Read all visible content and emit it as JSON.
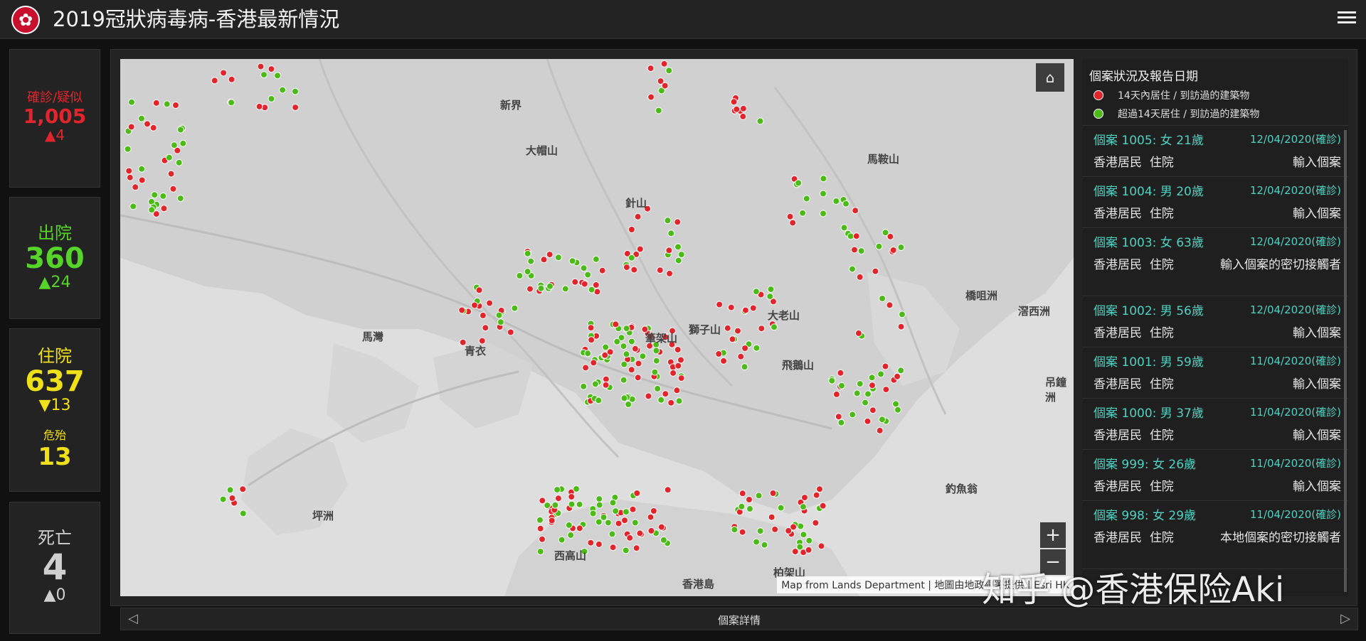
{
  "header": {
    "title": "2019冠狀病毒病-香港最新情況"
  },
  "stats": {
    "confirmed": {
      "label": "確診/疑似",
      "value": "1,005",
      "delta": "▲4",
      "color": "#e0262c"
    },
    "discharged": {
      "label": "出院",
      "value": "360",
      "delta": "▲24",
      "color": "#56d42a"
    },
    "hospitalised": {
      "label": "住院",
      "value": "637",
      "delta": "▼13",
      "critical_label": "危殆",
      "critical_value": "13",
      "color": "#f0e01a"
    },
    "deaths": {
      "label": "死亡",
      "value": "4",
      "delta": "▲0",
      "color": "#cfcfcf"
    }
  },
  "map": {
    "places": [
      "新界",
      "大帽山",
      "針山",
      "馬鞍山",
      "青衣",
      "馬灣",
      "筆架山",
      "獅子山",
      "大老山",
      "飛鵝山",
      "橋咀洲",
      "滘西洲",
      "吊鐘洲",
      "釣魚翁",
      "西高山",
      "香港島",
      "柏架山",
      "坪洲"
    ],
    "attribution": "Map from Lands Department | 地圖由地政總署提供 | Esri HK",
    "zoom_in": "+",
    "zoom_out": "−"
  },
  "legend": {
    "title": "個案狀況及報告日期",
    "items": [
      {
        "label": "14天內居住 / 到訪過的建築物",
        "color": "#e0262c"
      },
      {
        "label": "超過14天居住 / 到訪過的建築物",
        "color": "#4cbb17"
      }
    ]
  },
  "cases": [
    {
      "title": "個案 1005: 女  21歲",
      "date": "12/04/2020(確診)",
      "resident": "香港居民",
      "status": "住院",
      "source": "輸入個案"
    },
    {
      "title": "個案 1004: 男  20歲",
      "date": "12/04/2020(確診)",
      "resident": "香港居民",
      "status": "住院",
      "source": "輸入個案"
    },
    {
      "title": "個案 1003: 女  63歲",
      "date": "12/04/2020(確診)",
      "resident": "香港居民",
      "status": "住院",
      "source": "輸入個案的密切接觸者"
    },
    {
      "title": "個案 1002: 男  56歲",
      "date": "12/04/2020(確診)",
      "resident": "香港居民",
      "status": "住院",
      "source": "輸入個案"
    },
    {
      "title": "個案 1001: 男  59歲",
      "date": "11/04/2020(確診)",
      "resident": "香港居民",
      "status": "住院",
      "source": "輸入個案"
    },
    {
      "title": "個案 1000: 男  37歲",
      "date": "11/04/2020(確診)",
      "resident": "香港居民",
      "status": "住院",
      "source": "輸入個案"
    },
    {
      "title": "個案 999: 女  26歲",
      "date": "11/04/2020(確診)",
      "resident": "香港居民",
      "status": "住院",
      "source": "輸入個案"
    },
    {
      "title": "個案 998: 女  29歲",
      "date": "11/04/2020(確診)",
      "resident": "香港居民",
      "status": "住院",
      "source": "本地個案的密切接觸者"
    }
  ],
  "bottom": {
    "label": "個案詳情"
  },
  "watermark": "知乎 @香港保险Aki"
}
